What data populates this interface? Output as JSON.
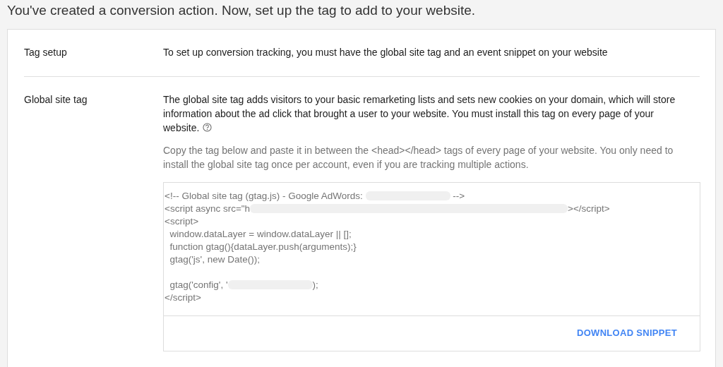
{
  "heading": "You've created a conversion action. Now, set up the tag to add to your website.",
  "sections": [
    {
      "label": "Tag setup",
      "text": "To set up conversion tracking, you must have the global site tag and an event snippet on your website"
    },
    {
      "label": "Global site tag",
      "text": "The global site tag adds visitors to your basic remarketing lists and sets new cookies on your domain, which will store information about the ad click that brought a user to your website. You must install this tag on every page of your website.",
      "instructions": "Copy the tag below and paste it in between the <head></head> tags of every page of your website. You only need to install the global site tag once per account, even if you are tracking multiple actions.",
      "code_lines": [
        [
          {
            "kind": "text",
            "text": "<!-- Global site tag (gtag.js) - Google AdWords: "
          },
          {
            "kind": "redacted_short"
          },
          {
            "kind": "text",
            "text": " -->"
          }
        ],
        [
          {
            "kind": "text",
            "text": "<script async src=\"h"
          },
          {
            "kind": "redacted_long"
          },
          {
            "kind": "text",
            "text": "></script>"
          }
        ],
        [
          {
            "kind": "text",
            "text": "<script>"
          }
        ],
        [
          {
            "kind": "text",
            "text": "  window.dataLayer = window.dataLayer || [];"
          }
        ],
        [
          {
            "kind": "text",
            "text": "  function gtag(){dataLayer.push(arguments);}"
          }
        ],
        [
          {
            "kind": "text",
            "text": "  gtag('js', new Date());"
          }
        ],
        [
          {
            "kind": "blank"
          }
        ],
        [
          {
            "kind": "text",
            "text": "  gtag('config', '"
          },
          {
            "kind": "redacted_short"
          },
          {
            "kind": "text",
            "text": ");"
          }
        ],
        [
          {
            "kind": "text",
            "text": "</script>"
          }
        ]
      ],
      "button": "DOWNLOAD SNIPPET"
    }
  ]
}
